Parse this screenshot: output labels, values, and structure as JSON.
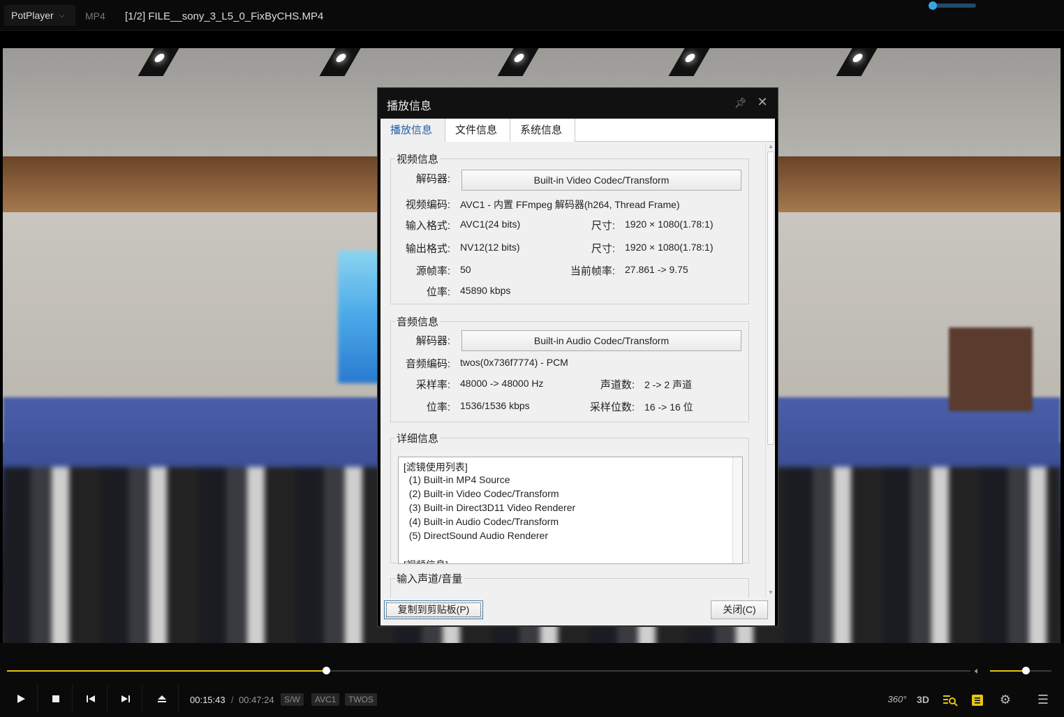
{
  "titlebar": {
    "app_name": "PotPlayer",
    "container_format": "MP4",
    "file_title": "[1/2] FILE__sony_3_L5_0_FixByCHS.MP4"
  },
  "dialog": {
    "title": "播放信息",
    "tabs": [
      {
        "label": "播放信息",
        "active": true
      },
      {
        "label": "文件信息",
        "active": false
      },
      {
        "label": "系统信息",
        "active": false
      }
    ],
    "video": {
      "legend": "视频信息",
      "decoder_label": "解码器:",
      "decoder_button": "Built-in Video Codec/Transform",
      "codec_label": "视频编码:",
      "codec_value": "AVC1 - 内置 FFmpeg 解码器(h264, Thread Frame)",
      "input_label": "输入格式:",
      "input_value": "AVC1(24 bits)",
      "input_size_label": "尺寸:",
      "input_size_value": "1920 × 1080(1.78:1)",
      "output_label": "输出格式:",
      "output_value": "NV12(12 bits)",
      "output_size_label": "尺寸:",
      "output_size_value": "1920 × 1080(1.78:1)",
      "src_fps_label": "源帧率:",
      "src_fps_value": "50",
      "cur_fps_label": "当前帧率:",
      "cur_fps_value": "27.861 -> 9.75",
      "bitrate_label": "位率:",
      "bitrate_value": "45890 kbps"
    },
    "audio": {
      "legend": "音频信息",
      "decoder_label": "解码器:",
      "decoder_button": "Built-in Audio Codec/Transform",
      "codec_label": "音频编码:",
      "codec_value": "twos(0x736f7774) - PCM",
      "samplerate_label": "采样率:",
      "samplerate_value": "48000 -> 48000 Hz",
      "channels_label": "声道数:",
      "channels_value": "2 -> 2 声道",
      "bitrate_label": "位率:",
      "bitrate_value": "1536/1536 kbps",
      "bits_label": "采样位数:",
      "bits_value": "16 -> 16 位"
    },
    "details": {
      "legend": "详细信息",
      "lines": [
        "[滤镜使用列表]",
        "  (1) Built-in MP4 Source",
        "  (2) Built-in Video Codec/Transform",
        "  (3) Built-in Direct3D11 Video Renderer",
        "  (4) Built-in Audio Codec/Transform",
        "  (5) DirectSound Audio Renderer",
        "",
        "[视频信息]"
      ]
    },
    "levels_legend": "输入声道/音量",
    "copy_button": "复制到剪贴板(P)",
    "close_button": "关闭(C)"
  },
  "controls": {
    "time_current": "00:15:43",
    "time_separator": "/",
    "time_total": "00:47:24",
    "seek_fraction": 0.3315,
    "volume_fraction": 0.58,
    "badges": [
      "S/W",
      "AVC1",
      "TWOS"
    ],
    "right_icons": {
      "vr": "360°",
      "stereo": "3D"
    }
  }
}
